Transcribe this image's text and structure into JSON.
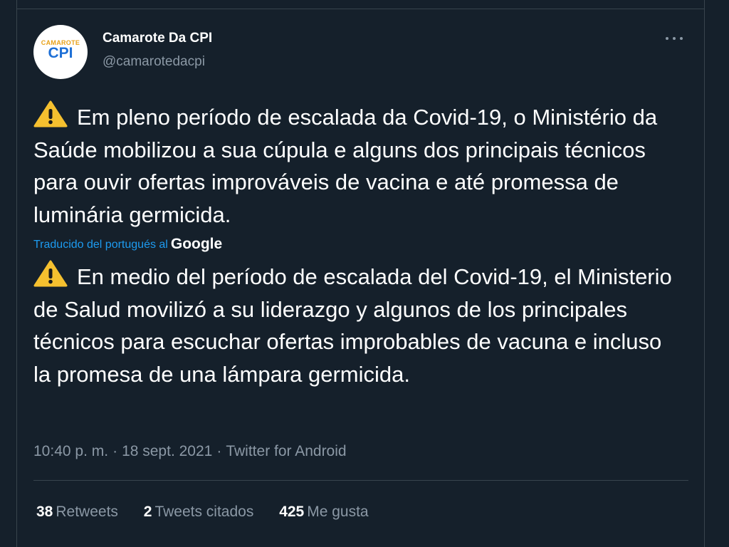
{
  "author": {
    "name": "Camarote Da CPI",
    "handle": "@camarotedacpi",
    "avatar": {
      "top_text": "CAMAROTE",
      "bottom_text": "CPI"
    }
  },
  "tweet": {
    "original_text": "Em pleno período de escalada da Covid-19, o Ministério da Saúde mobilizou a sua cúpula e alguns dos principais técnicos para ouvir ofertas improváveis de vacina e até promessa de luminária germicida.",
    "translated_by_label": "Traducido del portugués al",
    "translated_by_service": "Google",
    "translated_text": "En medio del período de escalada del Covid-19, el Ministerio de Salud movilizó a su liderazgo y algunos de los principales técnicos para escuchar ofertas improbables de vacuna e incluso la promesa de una lámpara germicida.",
    "warning_icon": "warning-sign-emoji"
  },
  "meta": {
    "time": "10:40 p. m.",
    "separator": "·",
    "date": "18 sept. 2021",
    "source": "Twitter for Android"
  },
  "stats": {
    "retweets": {
      "count": "38",
      "label": "Retweets"
    },
    "quotes": {
      "count": "2",
      "label": "Tweets citados"
    },
    "likes": {
      "count": "425",
      "label": "Me gusta"
    }
  },
  "colors": {
    "background": "#15202b",
    "text": "#ffffff",
    "secondary": "#8b98a5",
    "link": "#1d9bf0",
    "divider": "#38444d"
  }
}
